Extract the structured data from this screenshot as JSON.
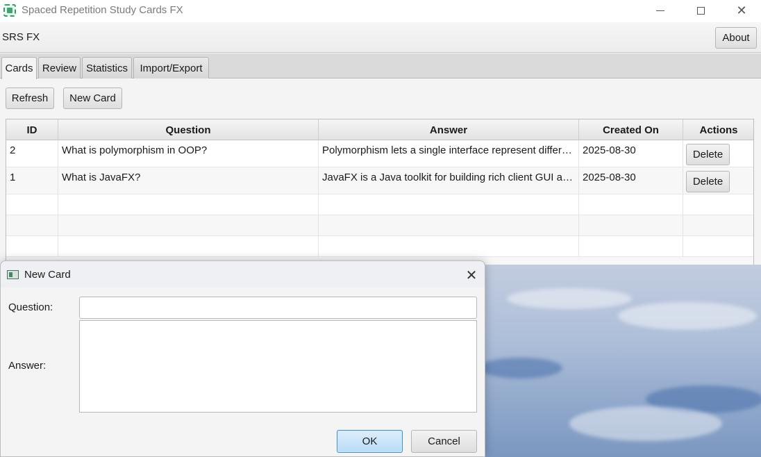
{
  "window": {
    "title": "Spaced Repetition Study Cards FX",
    "icon": "app-icon"
  },
  "menubar": {
    "brand": "SRS FX",
    "about_label": "About"
  },
  "tabs": [
    {
      "label": "Cards",
      "active": true
    },
    {
      "label": "Review",
      "active": false
    },
    {
      "label": "Statistics",
      "active": false
    },
    {
      "label": "Import/Export",
      "active": false
    }
  ],
  "toolbar": {
    "refresh_label": "Refresh",
    "new_card_label": "New Card"
  },
  "table": {
    "columns": [
      "ID",
      "Question",
      "Answer",
      "Created On",
      "Actions"
    ],
    "rows": [
      {
        "id": "2",
        "question": "What is polymorphism in OOP?",
        "answer": "Polymorphism lets a single interface represent differe…",
        "created_on": "2025-08-30",
        "action_label": "Delete"
      },
      {
        "id": "1",
        "question": "What is JavaFX?",
        "answer": "JavaFX is a Java toolkit for building rich client GUI ap…",
        "created_on": "2025-08-30",
        "action_label": "Delete"
      }
    ]
  },
  "dialog": {
    "title": "New Card",
    "icon": "window-icon",
    "question_label": "Question:",
    "answer_label": "Answer:",
    "question_value": "",
    "answer_value": "",
    "ok_label": "OK",
    "cancel_label": "Cancel"
  },
  "colors": {
    "accent": "#3a8ee0",
    "ok_button_bg": "#c9e4f9",
    "app_icon": "#2f9e64"
  }
}
